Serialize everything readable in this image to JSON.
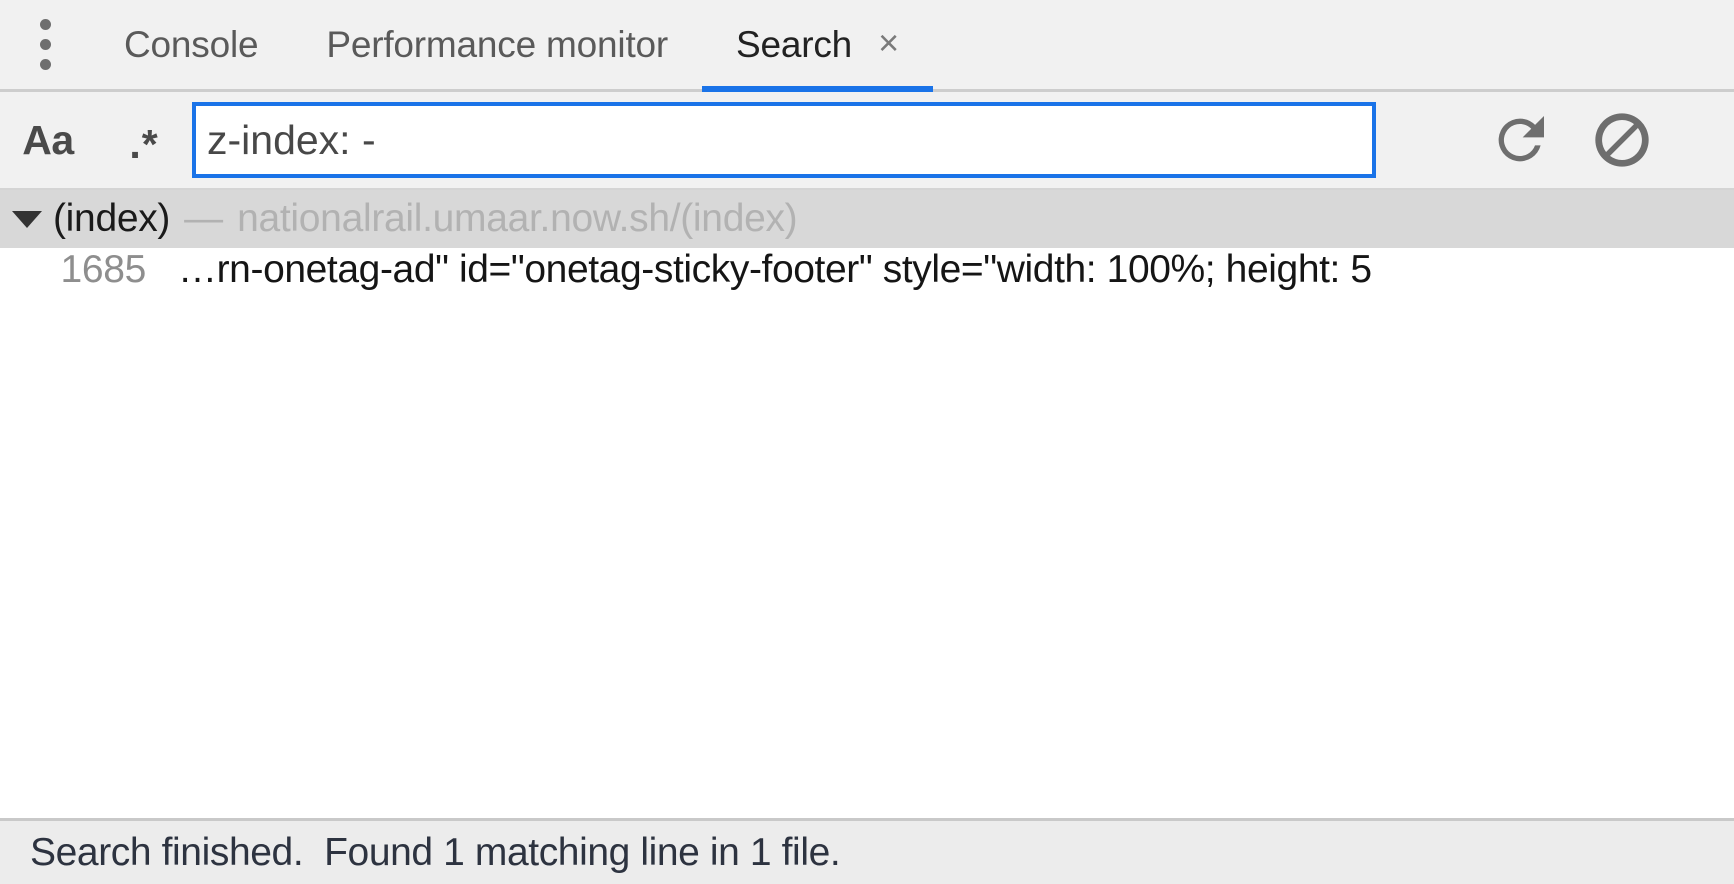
{
  "tabbar": {
    "menu_icon": "kebab-menu-icon",
    "tabs": [
      {
        "label": "Console",
        "active": false,
        "closeable": false
      },
      {
        "label": "Performance monitor",
        "active": false,
        "closeable": false
      },
      {
        "label": "Search",
        "active": true,
        "closeable": true,
        "close_glyph": "×"
      }
    ],
    "active_indicator_color": "#1a73e8"
  },
  "toolbar": {
    "match_case_label": "Aa",
    "regex_label": ".*",
    "search_value": "z-index: -",
    "search_placeholder": "Find",
    "refresh_icon": "refresh-icon",
    "clear_icon": "clear-icon"
  },
  "results": {
    "groups": [
      {
        "name": "(index)",
        "separator": "—",
        "url": "nationalrail.umaar.now.sh/(index)",
        "expanded": true,
        "matches": [
          {
            "line": "1685",
            "text": "…rn-onetag-ad\" id=\"onetag-sticky-footer\" style=\"width: 100%; height: 5"
          }
        ]
      }
    ]
  },
  "statusbar": {
    "message": "Search finished.  Found 1 matching line in 1 file."
  },
  "colors": {
    "accent": "#1a73e8",
    "toolbar_bg": "#f1f1f1",
    "group_header_bg": "#d8d8d8",
    "status_bg": "#ececec",
    "icon_gray": "#6e6e6e"
  }
}
